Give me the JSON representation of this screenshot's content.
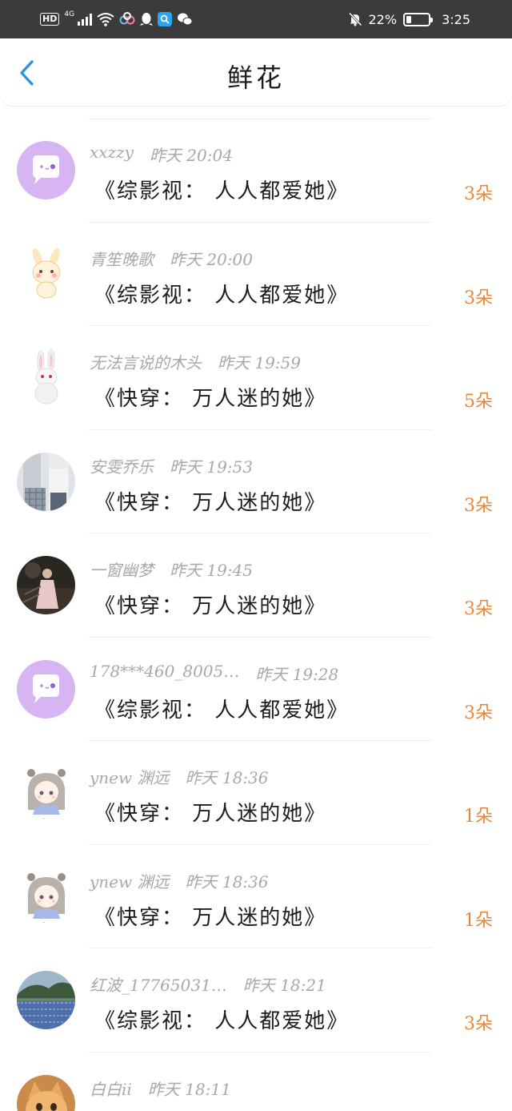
{
  "status_bar": {
    "hd": "HD",
    "network": "4G",
    "battery": "22%",
    "time": "3:25",
    "icons": [
      "hd-icon",
      "signal-icon",
      "wifi-icon",
      "cloud-app-icon",
      "qq-icon",
      "search-app-icon",
      "wechat-icon",
      "bell-off-icon",
      "battery-icon"
    ]
  },
  "header": {
    "title": "鲜花",
    "back_icon": "chevron-left-icon"
  },
  "items": [
    {
      "user": "xxzzy",
      "time": "昨天 20:04",
      "book": "《综影视： 人人都爱她》",
      "count": "3朵",
      "avatar": "purple-chat-default"
    },
    {
      "user": "青笙晚歌",
      "time": "昨天 20:00",
      "book": "《综影视： 人人都爱她》",
      "count": "3朵",
      "avatar": "cartoon-bunny"
    },
    {
      "user": "无法言说的木头",
      "time": "昨天 19:59",
      "book": "《快穿： 万人迷的她》",
      "count": "5朵",
      "avatar": "white-rabbit"
    },
    {
      "user": "安雯乔乐",
      "time": "昨天 19:53",
      "book": "《快穿： 万人迷的她》",
      "count": "3朵",
      "avatar": "photo-students"
    },
    {
      "user": "一窗幽梦",
      "time": "昨天 19:45",
      "book": "《快穿： 万人迷的她》",
      "count": "3朵",
      "avatar": "photo-dark-girl"
    },
    {
      "user": "178***460_8005…",
      "time": "昨天 19:28",
      "book": "《综影视： 人人都爱她》",
      "count": "3朵",
      "avatar": "purple-chat-default"
    },
    {
      "user": "ynew 渊远",
      "time": "昨天 18:36",
      "book": "《快穿： 万人迷的她》",
      "count": "1朵",
      "avatar": "anime-girl"
    },
    {
      "user": "ynew 渊远",
      "time": "昨天 18:36",
      "book": "《快穿： 万人迷的她》",
      "count": "1朵",
      "avatar": "anime-girl"
    },
    {
      "user": "红波_17765031…",
      "time": "昨天 18:21",
      "book": "《综影视： 人人都爱她》",
      "count": "3朵",
      "avatar": "photo-flower-field"
    },
    {
      "user": "白白ii",
      "time": "昨天 18:11",
      "book": "",
      "count": "",
      "avatar": "photo-orange-cat"
    }
  ]
}
